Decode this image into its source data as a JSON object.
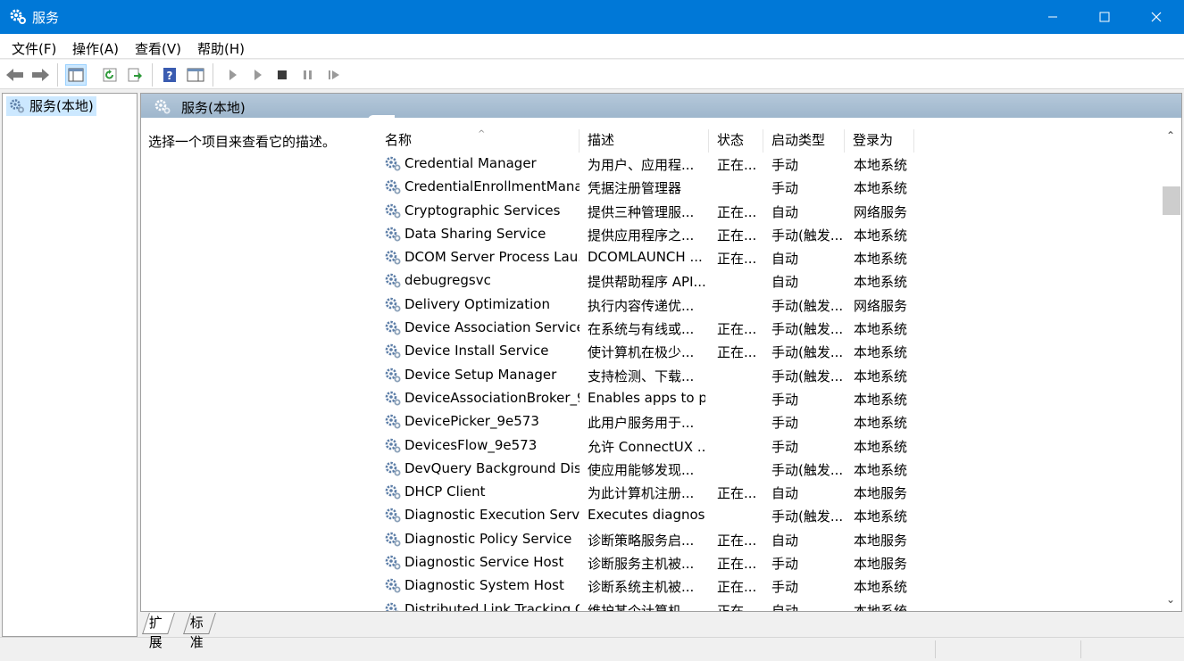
{
  "window": {
    "title": "服务",
    "icon": "gear-icon",
    "controls": [
      "minimize-icon",
      "maximize-icon",
      "close-icon"
    ]
  },
  "menu": [
    {
      "label": "文件(F)"
    },
    {
      "label": "操作(A)"
    },
    {
      "label": "查看(V)"
    },
    {
      "label": "帮助(H)"
    }
  ],
  "toolbar": {
    "buttons": [
      "back-arrow-icon",
      "forward-arrow-icon",
      "show-hide-console-tree-icon",
      "refresh-icon",
      "export-list-icon",
      "help-icon",
      "properties-pane-icon",
      "start-service-icon",
      "start-service-alt-icon",
      "stop-service-icon",
      "pause-service-icon",
      "restart-service-icon"
    ]
  },
  "tree": {
    "node_label": "服务(本地)"
  },
  "details": {
    "header_title": "服务(本地)",
    "description_prompt": "选择一个项目来查看它的描述。",
    "columns": [
      "名称",
      "描述",
      "状态",
      "启动类型",
      "登录为"
    ],
    "rows": [
      {
        "name": "Credential Manager",
        "desc": "为用户、应用程...",
        "status": "正在...",
        "startup": "手动",
        "logon": "本地系统"
      },
      {
        "name": "CredentialEnrollmentMana...",
        "desc": "凭据注册管理器",
        "status": "",
        "startup": "手动",
        "logon": "本地系统"
      },
      {
        "name": "Cryptographic Services",
        "desc": "提供三种管理服...",
        "status": "正在...",
        "startup": "自动",
        "logon": "网络服务"
      },
      {
        "name": "Data Sharing Service",
        "desc": "提供应用程序之...",
        "status": "正在...",
        "startup": "手动(触发...",
        "logon": "本地系统"
      },
      {
        "name": "DCOM Server Process Lau...",
        "desc": "DCOMLAUNCH ...",
        "status": "正在...",
        "startup": "自动",
        "logon": "本地系统"
      },
      {
        "name": "debugregsvc",
        "desc": "提供帮助程序 API...",
        "status": "",
        "startup": "自动",
        "logon": "本地系统"
      },
      {
        "name": "Delivery Optimization",
        "desc": "执行内容传递优...",
        "status": "",
        "startup": "手动(触发...",
        "logon": "网络服务"
      },
      {
        "name": "Device Association Service",
        "desc": "在系统与有线或...",
        "status": "正在...",
        "startup": "手动(触发...",
        "logon": "本地系统"
      },
      {
        "name": "Device Install Service",
        "desc": "使计算机在极少...",
        "status": "正在...",
        "startup": "手动(触发...",
        "logon": "本地系统"
      },
      {
        "name": "Device Setup Manager",
        "desc": "支持检测、下载...",
        "status": "",
        "startup": "手动(触发...",
        "logon": "本地系统"
      },
      {
        "name": "DeviceAssociationBroker_9...",
        "desc": "Enables apps to p...",
        "status": "",
        "startup": "手动",
        "logon": "本地系统"
      },
      {
        "name": "DevicePicker_9e573",
        "desc": "此用户服务用于...",
        "status": "",
        "startup": "手动",
        "logon": "本地系统"
      },
      {
        "name": "DevicesFlow_9e573",
        "desc": "允许 ConnectUX ...",
        "status": "",
        "startup": "手动",
        "logon": "本地系统"
      },
      {
        "name": "DevQuery Background Dis...",
        "desc": "使应用能够发现...",
        "status": "",
        "startup": "手动(触发...",
        "logon": "本地系统"
      },
      {
        "name": "DHCP Client",
        "desc": "为此计算机注册...",
        "status": "正在...",
        "startup": "自动",
        "logon": "本地服务"
      },
      {
        "name": "Diagnostic Execution Service",
        "desc": "Executes diagnos...",
        "status": "",
        "startup": "手动(触发...",
        "logon": "本地系统"
      },
      {
        "name": "Diagnostic Policy Service",
        "desc": "诊断策略服务启...",
        "status": "正在...",
        "startup": "自动",
        "logon": "本地服务"
      },
      {
        "name": "Diagnostic Service Host",
        "desc": "诊断服务主机被...",
        "status": "正在...",
        "startup": "手动",
        "logon": "本地服务"
      },
      {
        "name": "Diagnostic System Host",
        "desc": "诊断系统主机被...",
        "status": "正在...",
        "startup": "手动",
        "logon": "本地系统"
      },
      {
        "name": "Distributed Link Tracking C...",
        "desc": "维护某个计算机...",
        "status": "正在...",
        "startup": "自动",
        "logon": "本地系统"
      }
    ]
  },
  "tabs": [
    {
      "label": "扩展",
      "active": true
    },
    {
      "label": "标准",
      "active": false
    }
  ]
}
